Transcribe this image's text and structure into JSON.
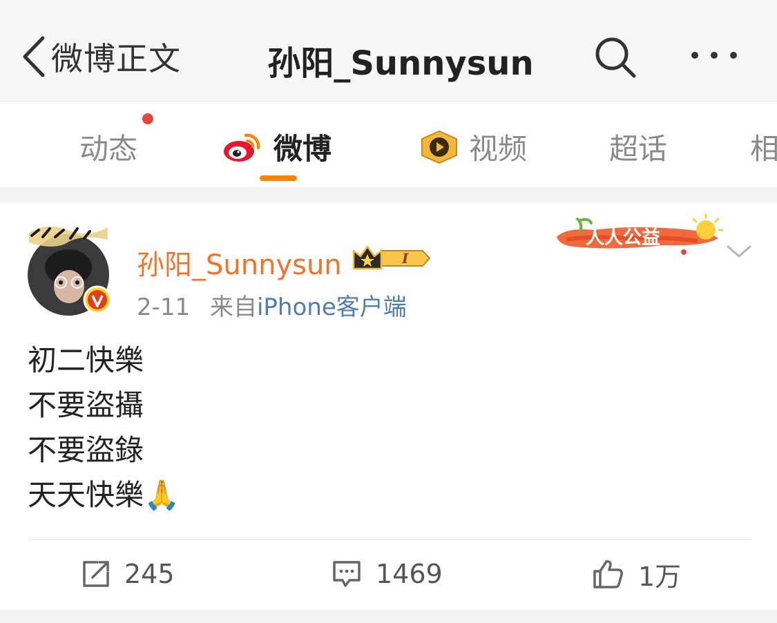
{
  "header": {
    "back_label": "微博正文",
    "title": "孙阳_Sunnysun"
  },
  "tabs": [
    {
      "label": "动态",
      "has_notification": true
    },
    {
      "label": "微博",
      "active": true,
      "icon": "weibo-logo-icon"
    },
    {
      "label": "视频",
      "icon": "video-play-icon"
    },
    {
      "label": "超话"
    },
    {
      "label": "相"
    }
  ],
  "post": {
    "author": "孙阳_Sunnysun",
    "member_badge": "I",
    "promo_banner": "人人公益",
    "date": "2-11",
    "from_label": "来自",
    "source": "iPhone客户端",
    "lines": [
      "初二快樂",
      "不要盜攝",
      "不要盜錄",
      "天天快樂🙏"
    ],
    "actions": {
      "repost_count": "245",
      "comment_count": "1469",
      "like_count": "1万"
    }
  },
  "colors": {
    "accent": "#ff8200",
    "author_name": "#f07328",
    "link": "#507daf",
    "notification_dot": "#e8453c"
  }
}
